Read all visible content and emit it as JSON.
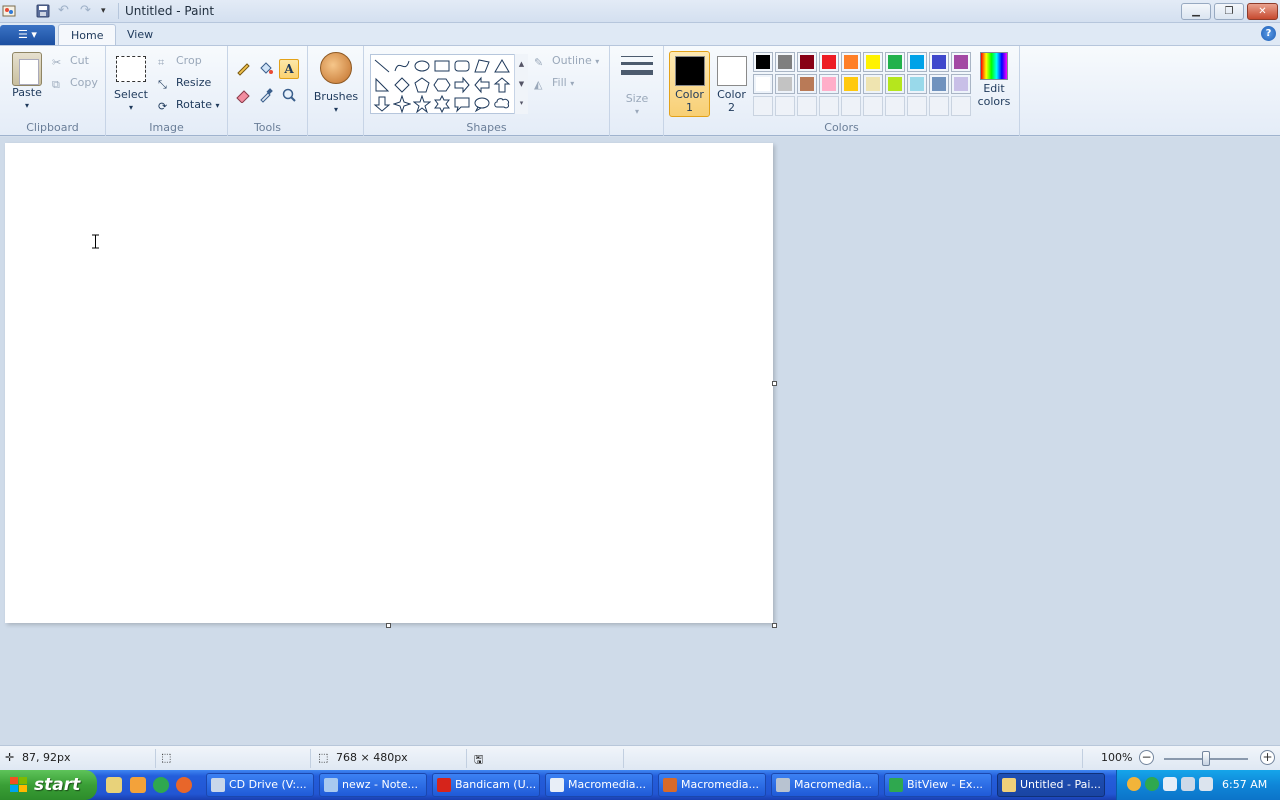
{
  "window": {
    "title": "Untitled - Paint",
    "icons": [
      "paint-app-icon",
      "save-icon",
      "undo-icon",
      "redo-icon",
      "customize-qat-icon"
    ]
  },
  "tabs": {
    "file_icon": "paint-menu-icon",
    "home": "Home",
    "view": "View",
    "help_glyph": "?"
  },
  "ribbon": {
    "clipboard": {
      "label": "Clipboard",
      "paste": "Paste",
      "cut": "Cut",
      "copy": "Copy"
    },
    "image": {
      "label": "Image",
      "select": "Select",
      "crop": "Crop",
      "resize": "Resize",
      "rotate": "Rotate"
    },
    "tools": {
      "label": "Tools",
      "text_glyph": "A"
    },
    "brushes": {
      "label": "Brushes"
    },
    "shapes": {
      "label": "Shapes",
      "outline": "Outline",
      "fill": "Fill"
    },
    "size": {
      "label": "Size"
    },
    "colors": {
      "label": "Colors",
      "color1_line1": "Color",
      "color1_line2": "1",
      "color2_line1": "Color",
      "color2_line2": "2",
      "color1_value": "#000000",
      "color2_value": "#ffffff",
      "edit_line1": "Edit",
      "edit_line2": "colors",
      "palette_row1": [
        "#000000",
        "#7f7f7f",
        "#880015",
        "#ed1c24",
        "#ff7f27",
        "#fff200",
        "#22b14c",
        "#00a2e8",
        "#3f48cc",
        "#a349a4"
      ],
      "palette_row2": [
        "#ffffff",
        "#c3c3c3",
        "#b97a57",
        "#ffaec9",
        "#ffc90e",
        "#efe4b0",
        "#b5e61d",
        "#99d9ea",
        "#7092be",
        "#c8bfe7"
      ],
      "palette_row3": [
        "",
        "",
        "",
        "",
        "",
        "",
        "",
        "",
        "",
        ""
      ]
    }
  },
  "status": {
    "cursor_pos": "87, 92px",
    "canvas_size": "768 × 480px",
    "zoom": "100%",
    "zoom_minus": "−",
    "zoom_plus": "+"
  },
  "taskbar": {
    "start": "start",
    "tasks": [
      {
        "label": "CD Drive (V:...",
        "icon_color": "#c9d7ea"
      },
      {
        "label": "newz - Note...",
        "icon_color": "#a8c9f0"
      },
      {
        "label": "Bandicam (U...",
        "icon_color": "#d6241b"
      },
      {
        "label": "Macromedia...",
        "icon_color": "#e8eef7"
      },
      {
        "label": "Macromedia...",
        "icon_color": "#d86a2a"
      },
      {
        "label": "Macromedia...",
        "icon_color": "#b8c3d1"
      },
      {
        "label": "BitView - Ex...",
        "icon_color": "#2fa84f"
      },
      {
        "label": "Untitled - Pai...",
        "icon_color": "#f0d07a"
      }
    ],
    "clock": "6:57 AM"
  }
}
